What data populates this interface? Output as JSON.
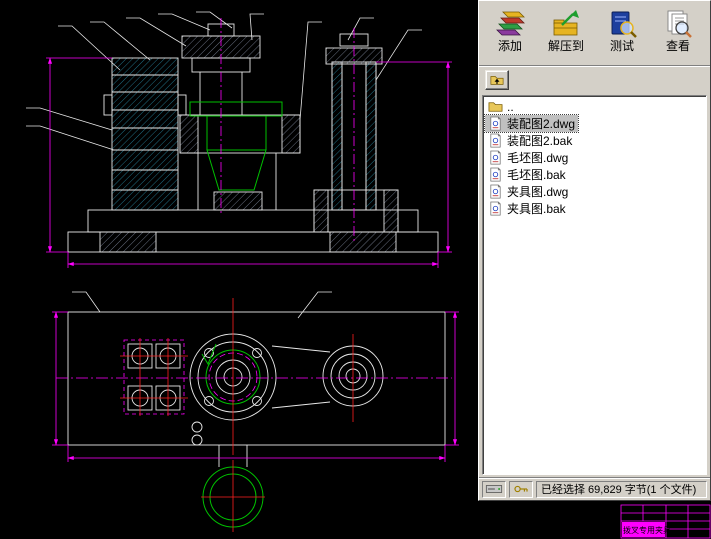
{
  "archive_panel": {
    "toolbar": {
      "buttons": [
        {
          "label": "添加",
          "icon": "add-books-icon"
        },
        {
          "label": "解压到",
          "icon": "extract-icon"
        },
        {
          "label": "测试",
          "icon": "test-icon"
        },
        {
          "label": "查看",
          "icon": "view-icon"
        }
      ]
    },
    "nav": {
      "up_icon": "up-folder-icon"
    },
    "files": [
      {
        "name": "..",
        "icon": "folder-up-icon",
        "selected": false
      },
      {
        "name": "装配图2.dwg",
        "icon": "dwg-file-icon",
        "selected": true
      },
      {
        "name": "装配图2.bak",
        "icon": "dwg-file-icon",
        "selected": false
      },
      {
        "name": "毛坯图.dwg",
        "icon": "dwg-file-icon",
        "selected": false
      },
      {
        "name": "毛坯图.bak",
        "icon": "dwg-file-icon",
        "selected": false
      },
      {
        "name": "夹具图.dwg",
        "icon": "dwg-file-icon",
        "selected": false
      },
      {
        "name": "夹具图.bak",
        "icon": "dwg-file-icon",
        "selected": false
      }
    ],
    "status": {
      "icons": [
        "archive-drive-icon",
        "key-icon"
      ],
      "text": "已经选择 69,829 字节(1 个文件)"
    }
  },
  "title_block": {
    "title": "拨叉专用夹具"
  },
  "colors": {
    "panel_bg": "#d4d0c8",
    "selection": "#c0c0c0",
    "cad_white": "#e8e8e8",
    "cad_green": "#00c000",
    "cad_magenta": "#ff00ff",
    "cad_red": "#ff2020",
    "cad_cyan": "#35b8dc"
  }
}
